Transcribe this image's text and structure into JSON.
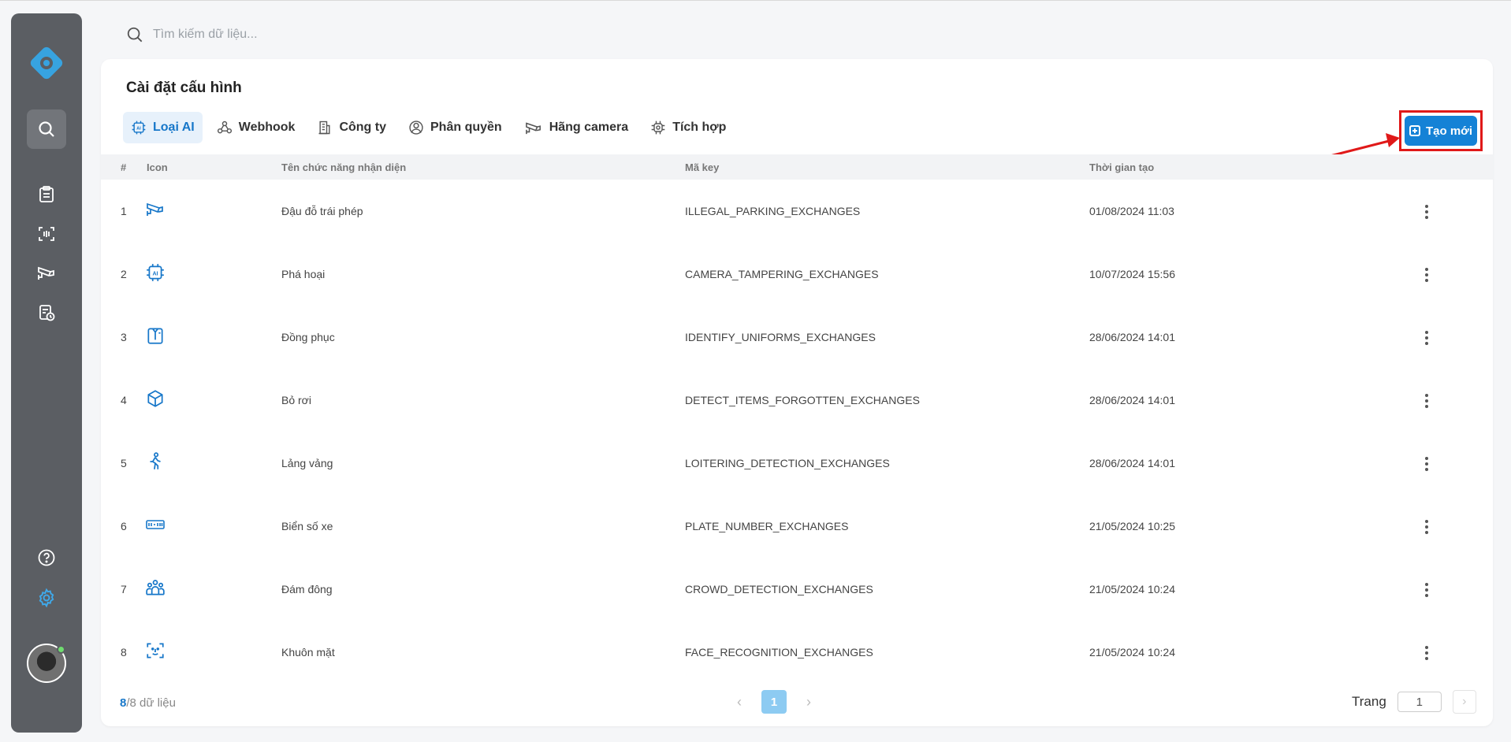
{
  "search": {
    "placeholder": "Tìm kiếm dữ liệu..."
  },
  "page": {
    "title": "Cài đặt cấu hình"
  },
  "tabs": [
    {
      "label": "Loại AI",
      "icon": "ai-chip-icon",
      "active": true
    },
    {
      "label": "Webhook",
      "icon": "webhook-icon",
      "active": false
    },
    {
      "label": "Công ty",
      "icon": "building-icon",
      "active": false
    },
    {
      "label": "Phân quyền",
      "icon": "user-group-icon",
      "active": false
    },
    {
      "label": "Hãng camera",
      "icon": "camera-icon",
      "active": false
    },
    {
      "label": "Tích hợp",
      "icon": "integration-icon",
      "active": false
    }
  ],
  "create_button": {
    "label": "Tạo mới"
  },
  "table": {
    "columns": [
      "#",
      "Icon",
      "Tên chức năng nhận diện",
      "Mã key",
      "Thời gian tạo"
    ],
    "rows": [
      {
        "num": "1",
        "icon": "cctv-camera-icon",
        "name": "Đậu đỗ trái phép",
        "key": "ILLEGAL_PARKING_EXCHANGES",
        "time": "01/08/2024 11:03"
      },
      {
        "num": "2",
        "icon": "ai-chip-icon",
        "name": "Phá hoại",
        "key": "CAMERA_TAMPERING_EXCHANGES",
        "time": "10/07/2024 15:56"
      },
      {
        "num": "3",
        "icon": "uniform-shirt-icon",
        "name": "Đồng phục",
        "key": "IDENTIFY_UNIFORMS_EXCHANGES",
        "time": "28/06/2024 14:01"
      },
      {
        "num": "4",
        "icon": "box-icon",
        "name": "Bỏ rơi",
        "key": "DETECT_ITEMS_FORGOTTEN_EXCHANGES",
        "time": "28/06/2024 14:01"
      },
      {
        "num": "5",
        "icon": "walking-person-icon",
        "name": "Lảng vảng",
        "key": "LOITERING_DETECTION_EXCHANGES",
        "time": "28/06/2024 14:01"
      },
      {
        "num": "6",
        "icon": "license-plate-icon",
        "name": "Biển số xe",
        "key": "PLATE_NUMBER_EXCHANGES",
        "time": "21/05/2024 10:25"
      },
      {
        "num": "7",
        "icon": "crowd-icon",
        "name": "Đám đông",
        "key": "CROWD_DETECTION_EXCHANGES",
        "time": "21/05/2024 10:24"
      },
      {
        "num": "8",
        "icon": "face-scan-icon",
        "name": "Khuôn mặt",
        "key": "FACE_RECOGNITION_EXCHANGES",
        "time": "21/05/2024 10:24"
      }
    ]
  },
  "footer": {
    "count_shown": "8",
    "count_total": "/8",
    "count_suffix": " dữ liệu",
    "current_page": "1",
    "goto_label": "Trang",
    "goto_value": "1"
  },
  "colors": {
    "accent": "#1582d6",
    "highlight": "#e01919",
    "sidebar": "#5b5e63",
    "icon": "#1777c9"
  }
}
